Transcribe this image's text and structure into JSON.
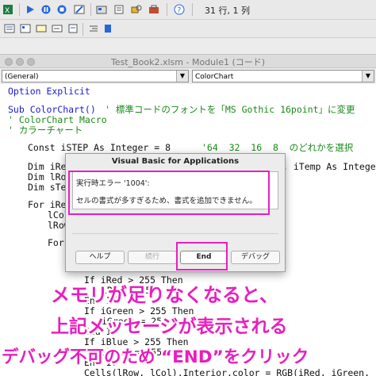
{
  "toolbar": {
    "cursor_position": "31 行, 1 列",
    "icons": [
      "run-icon",
      "pause-icon",
      "stop-icon",
      "design-mode-icon",
      "project-explorer-icon",
      "properties-icon",
      "object-browser-icon",
      "toolbox-icon"
    ]
  },
  "window": {
    "title": "Test_Book2.xlsm - Module1 (コード)"
  },
  "dropdowns": {
    "object": "(General)",
    "procedure": "ColorChart"
  },
  "code": {
    "lines": [
      {
        "text": "Option Explicit",
        "color": "blue"
      },
      {
        "text": "Sub ColorChart()",
        "color": "blue"
      },
      {
        "text": "' 標準コードのフォントを「MS Gothic 16point」に変更",
        "color": "green"
      },
      {
        "text": "' ColorChart Macro",
        "color": "green"
      },
      {
        "text": "' カラーチャート",
        "color": "green"
      },
      {
        "text": "Const iSTEP As Integer = 8",
        "color": "black"
      },
      {
        "text": "'64  32  16  8  のどれかを選択",
        "color": "green"
      },
      {
        "text": "Dim iRed",
        "color": "black"
      },
      {
        "text": ", iTemp As Integer",
        "color": "black"
      },
      {
        "text": "Dim lRow",
        "color": "black"
      },
      {
        "text": "Dim sTem",
        "color": "black"
      },
      {
        "text": "For iRed",
        "color": "black"
      },
      {
        "text": "lCol",
        "color": "black"
      },
      {
        "text": "lRow",
        "color": "black"
      },
      {
        "text": "For",
        "color": "black"
      },
      {
        "text": "If iRed > 255 Then",
        "color": "black"
      },
      {
        "text": "iRed = 255",
        "color": "black"
      },
      {
        "text": "End If",
        "color": "black"
      },
      {
        "text": "If iGreen > 255 Then",
        "color": "black"
      },
      {
        "text": "iGreen = 255",
        "color": "black"
      },
      {
        "text": "End If",
        "color": "black"
      },
      {
        "text": "If iBlue > 255 Then",
        "color": "black"
      },
      {
        "text": "iBlue = 255",
        "color": "black"
      },
      {
        "text": "End If",
        "color": "black"
      },
      {
        "text": "Cells(lRow, lCol).Interior.color = RGB(iRed, iGreen, iBlue)",
        "color": "black"
      }
    ]
  },
  "dialog": {
    "title": "Visual Basic for Applications",
    "error_line": "実行時エラー '1004':",
    "message": "セルの書式が多すぎるため、書式を追加できません。",
    "buttons": {
      "help": "ヘルプ",
      "continue": "続行",
      "end": "End",
      "debug": "デバッグ"
    }
  },
  "annotations": {
    "line1": "メモリが足りなくなると、",
    "line2": "上記メッセージが表示される",
    "line3": "デバッグ不可のため “END”をクリック",
    "color": "#e81fbe"
  }
}
